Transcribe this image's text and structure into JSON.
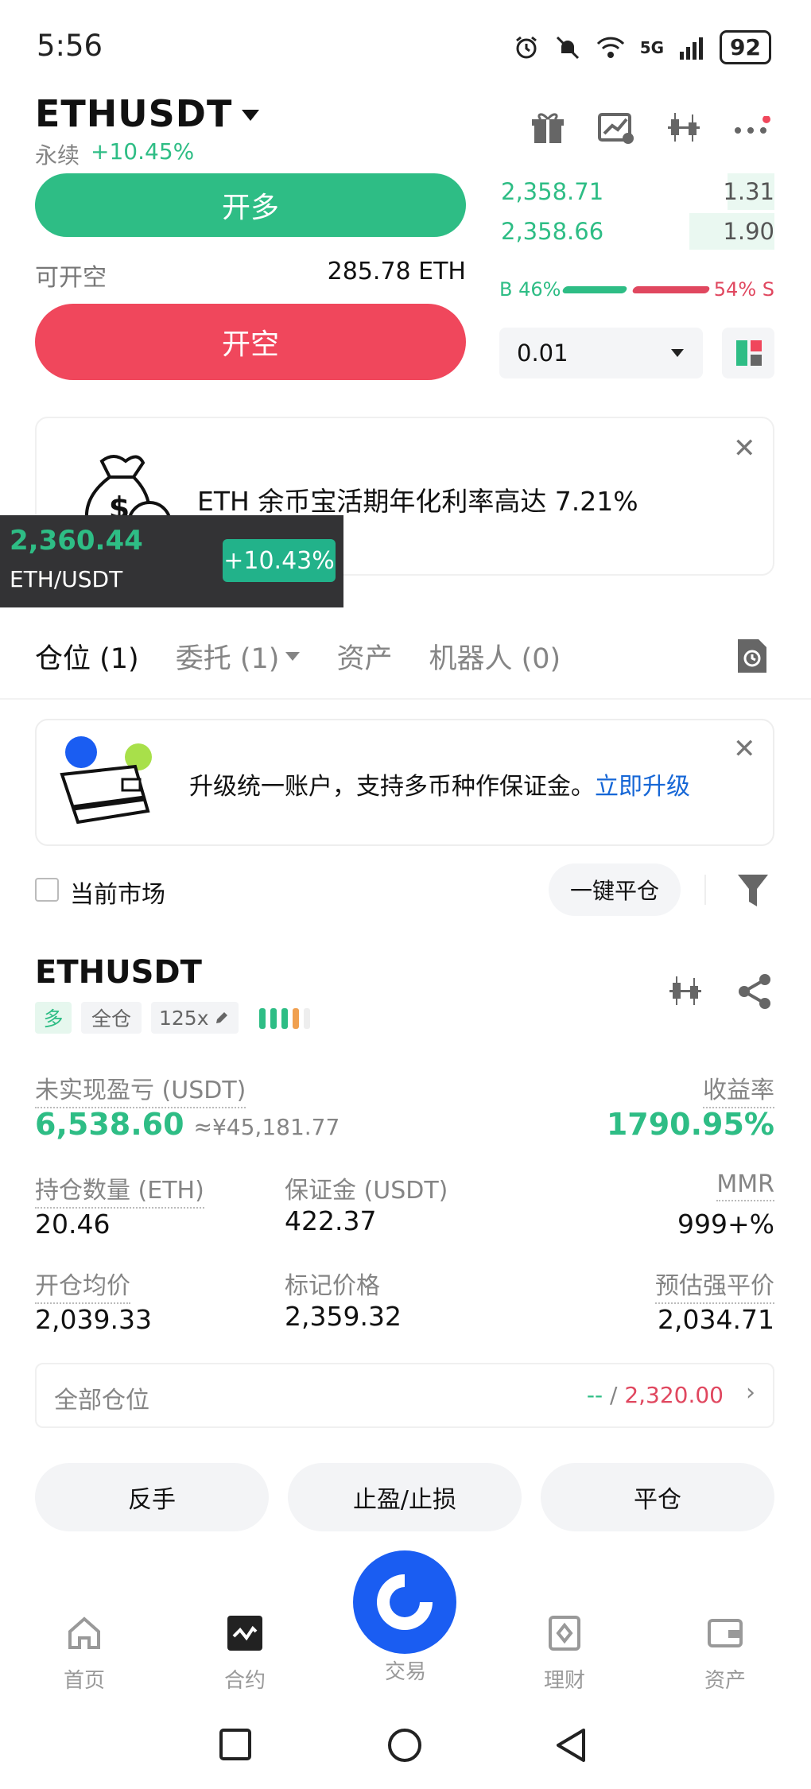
{
  "status": {
    "time": "5:56",
    "battery": "92",
    "network": "5G"
  },
  "header": {
    "pair": "ETHUSDT",
    "type": "永续",
    "change": "+10.45%"
  },
  "trade": {
    "long_label": "开多",
    "short_label": "开空",
    "available_label": "可开空",
    "available_value": "285.78 ETH"
  },
  "orderbook": {
    "rows": [
      {
        "price": "2,358.71",
        "qty": "1.31",
        "depth": 0.17
      },
      {
        "price": "2,358.66",
        "qty": "1.90",
        "depth": 0.31
      }
    ],
    "buy_ratio": "B 46%",
    "sell_ratio": "54% S",
    "buy_fraction": 0.46,
    "quantity_select": "0.01"
  },
  "promo": {
    "text": "ETH 余币宝活期年化利率高达 7.21%"
  },
  "ticker": {
    "price": "2,360.44",
    "pair": "ETH/USDT",
    "change": "+10.43%"
  },
  "tabs": [
    {
      "label": "仓位 (1)"
    },
    {
      "label": "委托 (1)"
    },
    {
      "label": "资产"
    },
    {
      "label": "机器人 (0)"
    }
  ],
  "upgrade": {
    "text": "升级统一账户，支持多币种作保证金。",
    "link": "立即升级"
  },
  "filters": {
    "current_market": "当前市场",
    "close_all": "一键平仓"
  },
  "position": {
    "symbol": "ETHUSDT",
    "side_tag": "多",
    "margin_tag": "全仓",
    "leverage_tag": "125x",
    "upnl_label": "未实现盈亏 (USDT)",
    "upnl_value": "6,538.60",
    "upnl_cny": "≈¥45,181.77",
    "roe_label": "收益率",
    "roe_value": "1790.95%",
    "size_label": "持仓数量 (ETH)",
    "size_value": "20.46",
    "margin_label": "保证金 (USDT)",
    "margin_value": "422.37",
    "mmr_label": "MMR",
    "mmr_value": "999+%",
    "entry_label": "开仓均价",
    "entry_value": "2,039.33",
    "mark_label": "标记价格",
    "mark_value": "2,359.32",
    "liq_label": "预估强平价",
    "liq_value": "2,034.71",
    "all_positions_label": "全部仓位",
    "all_positions_tp": "--",
    "all_positions_sep": " / ",
    "all_positions_sl": "2,320.00"
  },
  "actions": {
    "reverse": "反手",
    "tpsl": "止盈/止损",
    "close": "平仓"
  },
  "nav": {
    "home": "首页",
    "futures": "合约",
    "trade": "交易",
    "earn": "理财",
    "assets": "资产"
  },
  "colors": {
    "green": "#2ebd85",
    "red": "#f0475c",
    "blue": "#1a5df2",
    "orange": "#f0a050"
  }
}
